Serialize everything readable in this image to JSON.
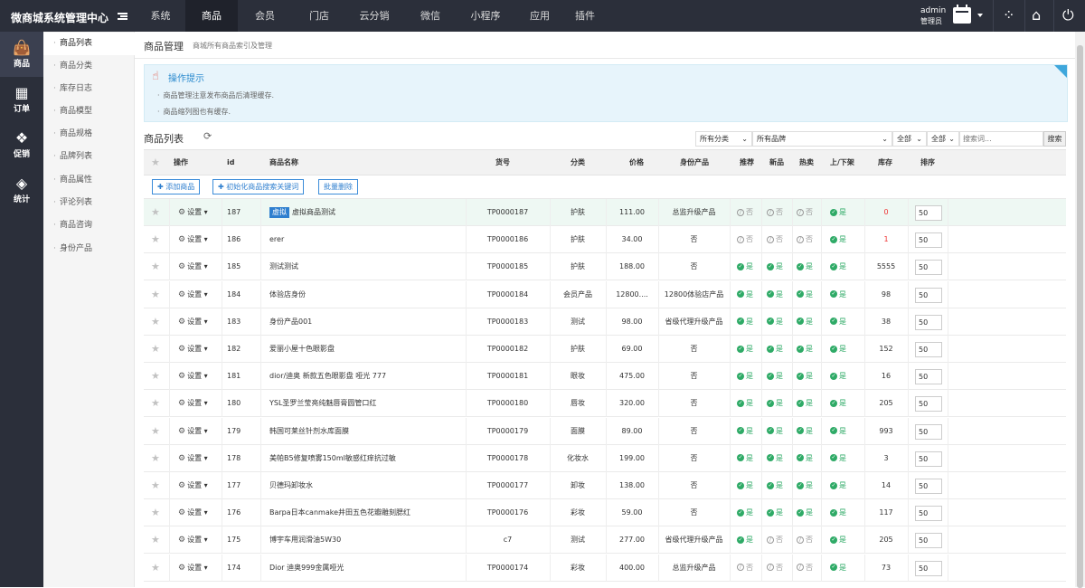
{
  "app": {
    "title": "微商城系统管理中心",
    "nav": [
      "系统",
      "商品",
      "会员",
      "门店",
      "云分销",
      "微信",
      "小程序",
      "应用",
      "插件"
    ],
    "active_nav": "商品",
    "user": {
      "name": "admin",
      "role": "管理员"
    }
  },
  "sidebar": {
    "items": [
      {
        "label": "商品",
        "icon": "shopping-bag-icon"
      },
      {
        "label": "订单",
        "icon": "store-icon"
      },
      {
        "label": "促销",
        "icon": "gift-icon"
      },
      {
        "label": "统计",
        "icon": "chart-icon"
      }
    ]
  },
  "subnav": {
    "items": [
      "商品列表",
      "商品分类",
      "库存日志",
      "商品模型",
      "商品规格",
      "品牌列表",
      "商品属性",
      "评论列表",
      "商品咨询",
      "身份产品"
    ]
  },
  "page": {
    "title": "商品管理",
    "subtitle": "商城所有商品索引及管理"
  },
  "tips": {
    "title": "操作提示",
    "items": [
      "商品管理注意发布商品后清理缓存.",
      "商品缩列图也有缓存."
    ]
  },
  "list": {
    "title": "商品列表",
    "filters": {
      "category": "所有分类",
      "brand": "所有品牌",
      "filter3": "全部",
      "filter4": "全部",
      "search_placeholder": "搜索词...",
      "search_button": "搜索"
    },
    "columns": [
      "操作",
      "id",
      "商品名称",
      "货号",
      "分类",
      "价格",
      "身份产品",
      "推荐",
      "新品",
      "热卖",
      "上/下架",
      "库存",
      "排序"
    ],
    "action_buttons": [
      "添加商品",
      "初始化商品搜索关键词",
      "批量删除"
    ],
    "settings_label": "设置",
    "yes_label": "是",
    "no_label": "否",
    "rows": [
      {
        "id": "187",
        "tag": "虚拟",
        "name": "虚拟商品测试",
        "sku": "TP0000187",
        "category": "护肤",
        "price": "111.00",
        "identity": "总监升级产品",
        "recommend": false,
        "new": false,
        "hot": false,
        "onsale": true,
        "stock": "0",
        "stock_red": true,
        "sort": "50"
      },
      {
        "id": "186",
        "tag": "",
        "name": "erer",
        "sku": "TP0000186",
        "category": "护肤",
        "price": "34.00",
        "identity": "否",
        "recommend": false,
        "new": false,
        "hot": false,
        "onsale": true,
        "stock": "1",
        "stock_red": true,
        "sort": "50"
      },
      {
        "id": "185",
        "tag": "",
        "name": "测试测试",
        "sku": "TP0000185",
        "category": "护肤",
        "price": "188.00",
        "identity": "否",
        "recommend": true,
        "new": true,
        "hot": true,
        "onsale": true,
        "stock": "5555",
        "stock_red": false,
        "sort": "50"
      },
      {
        "id": "184",
        "tag": "",
        "name": "体验店身份",
        "sku": "TP0000184",
        "category": "会员产品",
        "price": "12800....",
        "identity": "12800体验店产品",
        "recommend": true,
        "new": true,
        "hot": true,
        "onsale": true,
        "stock": "98",
        "stock_red": false,
        "sort": "50"
      },
      {
        "id": "183",
        "tag": "",
        "name": "身份产品001",
        "sku": "TP0000183",
        "category": "测试",
        "price": "98.00",
        "identity": "省级代理升级产品",
        "recommend": true,
        "new": true,
        "hot": true,
        "onsale": true,
        "stock": "38",
        "stock_red": false,
        "sort": "50"
      },
      {
        "id": "182",
        "tag": "",
        "name": "爱丽小屋十色眼影盘",
        "sku": "TP0000182",
        "category": "护肤",
        "price": "69.00",
        "identity": "否",
        "recommend": true,
        "new": true,
        "hot": true,
        "onsale": true,
        "stock": "152",
        "stock_red": false,
        "sort": "50"
      },
      {
        "id": "181",
        "tag": "",
        "name": "dior/迪奥 新款五色眼影盘 哑光 777",
        "sku": "TP0000181",
        "category": "眼妆",
        "price": "475.00",
        "identity": "否",
        "recommend": true,
        "new": true,
        "hot": true,
        "onsale": true,
        "stock": "16",
        "stock_red": false,
        "sort": "50"
      },
      {
        "id": "180",
        "tag": "",
        "name": "YSL圣罗兰莹亮纯魅唇膏圆管口红",
        "sku": "TP0000180",
        "category": "唇妆",
        "price": "320.00",
        "identity": "否",
        "recommend": true,
        "new": true,
        "hot": true,
        "onsale": true,
        "stock": "205",
        "stock_red": false,
        "sort": "50"
      },
      {
        "id": "179",
        "tag": "",
        "name": "韩国可莱丝针剂水库面膜",
        "sku": "TP0000179",
        "category": "面膜",
        "price": "89.00",
        "identity": "否",
        "recommend": true,
        "new": true,
        "hot": true,
        "onsale": true,
        "stock": "993",
        "stock_red": false,
        "sort": "50"
      },
      {
        "id": "178",
        "tag": "",
        "name": "美帕B5修复喷雾150ml敏感红痒抗过敏",
        "sku": "TP0000178",
        "category": "化妆水",
        "price": "199.00",
        "identity": "否",
        "recommend": true,
        "new": true,
        "hot": true,
        "onsale": true,
        "stock": "3",
        "stock_red": false,
        "sort": "50"
      },
      {
        "id": "177",
        "tag": "",
        "name": "贝德玛卸妆水",
        "sku": "TP0000177",
        "category": "卸妆",
        "price": "138.00",
        "identity": "否",
        "recommend": true,
        "new": true,
        "hot": true,
        "onsale": true,
        "stock": "14",
        "stock_red": false,
        "sort": "50"
      },
      {
        "id": "176",
        "tag": "",
        "name": "Barpa日本canmake井田五色花瓣雕刻腮红",
        "sku": "TP0000176",
        "category": "彩妆",
        "price": "59.00",
        "identity": "否",
        "recommend": true,
        "new": true,
        "hot": true,
        "onsale": true,
        "stock": "117",
        "stock_red": false,
        "sort": "50"
      },
      {
        "id": "175",
        "tag": "",
        "name": "博宇车用润滑油5W30",
        "sku": "c7",
        "category": "测试",
        "price": "277.00",
        "identity": "省级代理升级产品",
        "recommend": true,
        "new": false,
        "hot": false,
        "onsale": true,
        "stock": "205",
        "stock_red": false,
        "sort": "50"
      },
      {
        "id": "174",
        "tag": "",
        "name": "Dior 迪奥999金属哑光",
        "sku": "TP0000174",
        "category": "彩妆",
        "price": "400.00",
        "identity": "总监升级产品",
        "recommend": false,
        "new": false,
        "hot": false,
        "onsale": true,
        "stock": "73",
        "stock_red": false,
        "sort": "50"
      }
    ]
  },
  "colors": {
    "accent": "#2f7fcf",
    "yes": "#2eaa66",
    "danger": "#e33333",
    "topbar": "#2b2f3a"
  }
}
